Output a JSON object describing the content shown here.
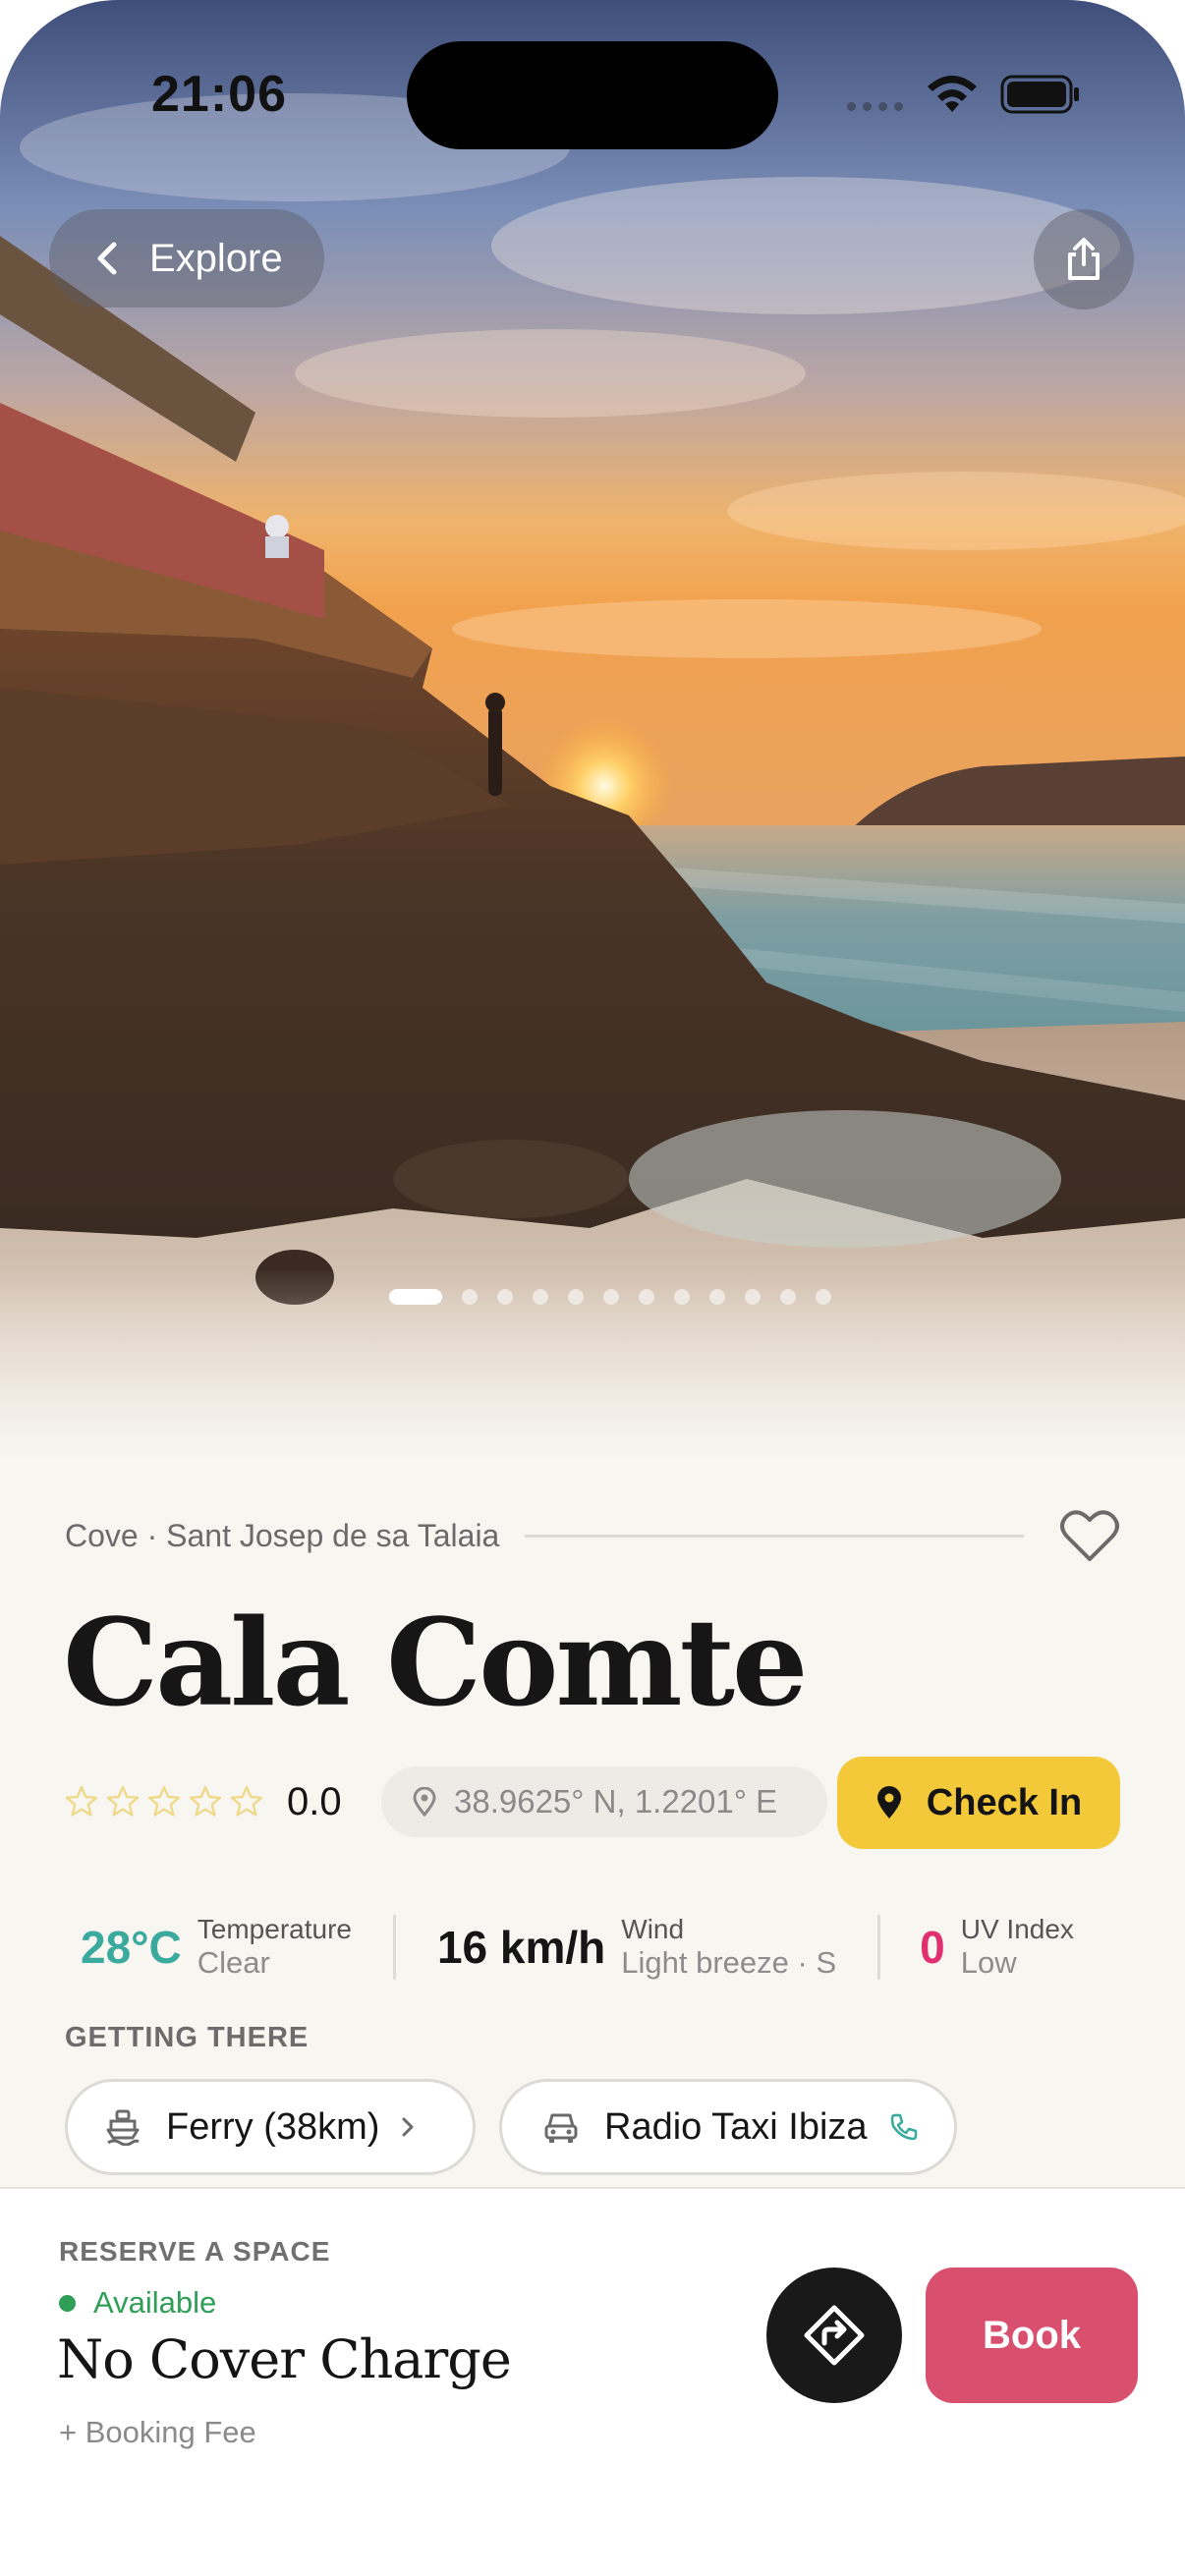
{
  "status_bar": {
    "time": "21:06"
  },
  "nav": {
    "back_label": "Explore",
    "back_icon": "chevron-left-icon",
    "share_icon": "share-icon"
  },
  "gallery": {
    "photo_count": 12,
    "active_index": 0,
    "photo_description_icon": "hero-photo"
  },
  "place": {
    "category_line": "Cove · Sant Josep de sa Talaia",
    "name": "Cala Comte",
    "rating": "0.0",
    "stars_filled": 0,
    "stars_total": 5,
    "coordinates": "38.9625° N, 1.2201° E",
    "check_in_label": "Check In"
  },
  "weather": {
    "temperature": {
      "value": "28°C",
      "label": "Temperature",
      "detail": "Clear",
      "color": "#3aa99e"
    },
    "wind": {
      "value": "16 km/h",
      "label": "Wind",
      "detail": "Light breeze · S",
      "color": "#151515"
    },
    "uv": {
      "value": "0",
      "label": "UV Index",
      "detail": "Low",
      "color": "#e0306f"
    }
  },
  "getting_there": {
    "heading": "GETTING THERE",
    "options": [
      {
        "label": "Ferry (38km)",
        "icon": "ferry-icon",
        "trailing_icon": "chevron-right-icon"
      },
      {
        "label": "Radio Taxi Ibiza",
        "icon": "taxi-icon",
        "trailing_icon": "phone-icon"
      }
    ]
  },
  "reserve": {
    "heading": "RESERVE A SPACE",
    "availability": "Available",
    "price": "No Cover Charge",
    "fee_note": "+ Booking Fee",
    "book_label": "Book",
    "directions_icon": "directions-icon"
  },
  "colors": {
    "accent_yellow": "#f3c93a",
    "book_pink": "#d9506e",
    "available_green": "#2f9e57",
    "background": "#f8f6f1"
  }
}
